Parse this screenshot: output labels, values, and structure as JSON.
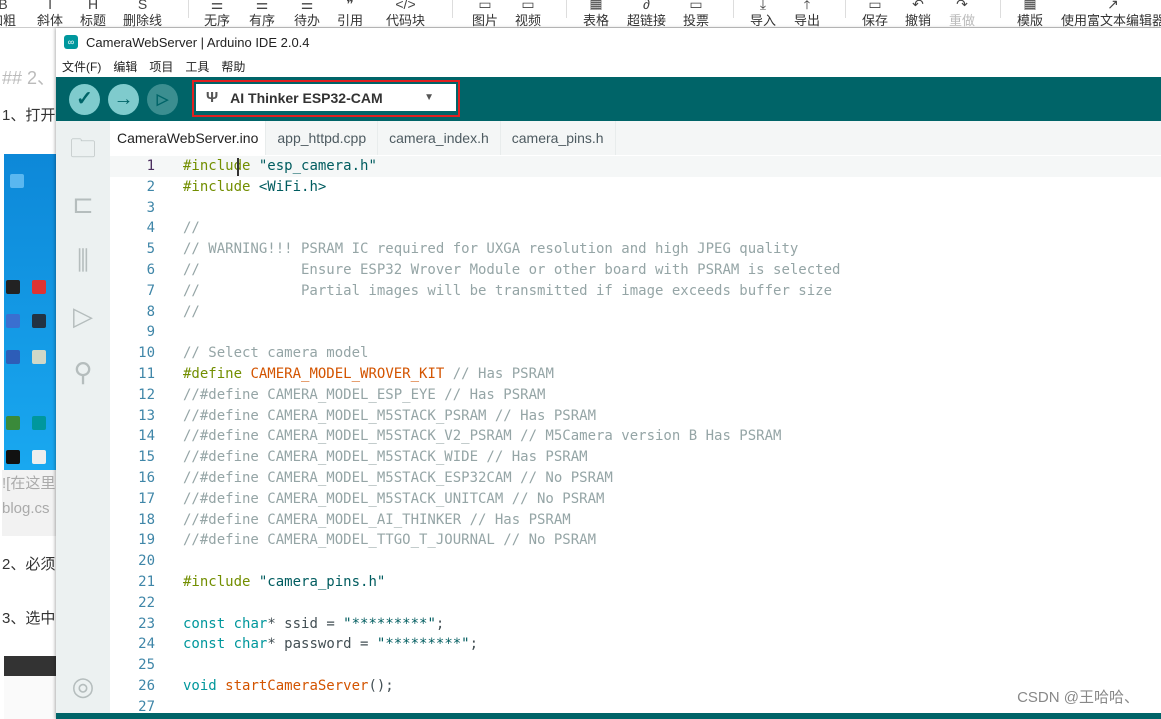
{
  "background_editor": {
    "toolbar": [
      {
        "label": "加粗",
        "icon": "bold-icon",
        "glyph": "B"
      },
      {
        "label": "斜体",
        "icon": "italic-icon",
        "glyph": "I"
      },
      {
        "label": "标题",
        "icon": "heading-icon",
        "glyph": "H"
      },
      {
        "label": "删除线",
        "icon": "strikethrough-icon",
        "glyph": "S"
      },
      {
        "label": "无序",
        "icon": "unordered-list-icon",
        "glyph": "☰"
      },
      {
        "label": "有序",
        "icon": "ordered-list-icon",
        "glyph": "☰"
      },
      {
        "label": "待办",
        "icon": "todo-icon",
        "glyph": "☰"
      },
      {
        "label": "引用",
        "icon": "quote-icon",
        "glyph": "❞"
      },
      {
        "label": "代码块",
        "icon": "code-block-icon",
        "glyph": "</>"
      },
      {
        "label": "图片",
        "icon": "image-icon",
        "glyph": "▭"
      },
      {
        "label": "视频",
        "icon": "video-icon",
        "glyph": "▭"
      },
      {
        "label": "表格",
        "icon": "table-icon",
        "glyph": "▦"
      },
      {
        "label": "超链接",
        "icon": "link-icon",
        "glyph": "∂"
      },
      {
        "label": "投票",
        "icon": "vote-icon",
        "glyph": "▭"
      },
      {
        "label": "导入",
        "icon": "import-icon",
        "glyph": "⤓"
      },
      {
        "label": "导出",
        "icon": "export-icon",
        "glyph": "⤒"
      },
      {
        "label": "保存",
        "icon": "save-icon",
        "glyph": "▭"
      },
      {
        "label": "撤销",
        "icon": "undo-icon",
        "glyph": "↶"
      },
      {
        "label": "重做",
        "icon": "redo-icon",
        "glyph": "↷"
      },
      {
        "label": "模版",
        "icon": "template-icon",
        "glyph": "▦"
      },
      {
        "label": "使用富文本编辑器",
        "icon": "rich-text-icon",
        "glyph": "↗"
      }
    ],
    "content": {
      "heading": "## 2、",
      "step1": "1、打开",
      "image_alt": "![在这里",
      "image_url": "blog.cs",
      "step2": "2、必须",
      "step3": "3、选中"
    },
    "watermark": "CSDN @王哈哈、"
  },
  "ide": {
    "title": "CameraWebServer | Arduino IDE 2.0.4",
    "menu": [
      "文件(F)",
      "编辑",
      "项目",
      "工具",
      "帮助"
    ],
    "board": "AI Thinker ESP32-CAM",
    "colors": {
      "toolbar": "#006468",
      "highlight_box": "#e02020"
    },
    "tabs": [
      "CameraWebServer.ino",
      "app_httpd.cpp",
      "camera_index.h",
      "camera_pins.h"
    ],
    "active_tab": 0,
    "code": [
      [
        [
          "pre",
          "#include"
        ],
        [
          "plain",
          " "
        ],
        [
          "str",
          "\"esp_camera.h\""
        ]
      ],
      [
        [
          "pre",
          "#include"
        ],
        [
          "plain",
          " "
        ],
        [
          "str",
          "<WiFi.h>"
        ]
      ],
      [],
      [
        [
          "com",
          "//"
        ]
      ],
      [
        [
          "com",
          "// WARNING!!! PSRAM IC required for UXGA resolution and high JPEG quality"
        ]
      ],
      [
        [
          "com",
          "//            Ensure ESP32 Wrover Module or other board with PSRAM is selected"
        ]
      ],
      [
        [
          "com",
          "//            Partial images will be transmitted if image exceeds buffer size"
        ]
      ],
      [
        [
          "com",
          "//"
        ]
      ],
      [],
      [
        [
          "com",
          "// Select camera model"
        ]
      ],
      [
        [
          "pre",
          "#define"
        ],
        [
          "plain",
          " "
        ],
        [
          "mac",
          "CAMERA_MODEL_WROVER_KIT"
        ],
        [
          "com",
          " // Has PSRAM"
        ]
      ],
      [
        [
          "com",
          "//#define CAMERA_MODEL_ESP_EYE // Has PSRAM"
        ]
      ],
      [
        [
          "com",
          "//#define CAMERA_MODEL_M5STACK_PSRAM // Has PSRAM"
        ]
      ],
      [
        [
          "com",
          "//#define CAMERA_MODEL_M5STACK_V2_PSRAM // M5Camera version B Has PSRAM"
        ]
      ],
      [
        [
          "com",
          "//#define CAMERA_MODEL_M5STACK_WIDE // Has PSRAM"
        ]
      ],
      [
        [
          "com",
          "//#define CAMERA_MODEL_M5STACK_ESP32CAM // No PSRAM"
        ]
      ],
      [
        [
          "com",
          "//#define CAMERA_MODEL_M5STACK_UNITCAM // No PSRAM"
        ]
      ],
      [
        [
          "com",
          "//#define CAMERA_MODEL_AI_THINKER // Has PSRAM"
        ]
      ],
      [
        [
          "com",
          "//#define CAMERA_MODEL_TTGO_T_JOURNAL // No PSRAM"
        ]
      ],
      [],
      [
        [
          "pre",
          "#include"
        ],
        [
          "plain",
          " "
        ],
        [
          "str",
          "\"camera_pins.h\""
        ]
      ],
      [],
      [
        [
          "kw",
          "const"
        ],
        [
          "plain",
          " "
        ],
        [
          "kw",
          "char"
        ],
        [
          "plain",
          "* ssid = "
        ],
        [
          "str",
          "\"*********\""
        ],
        [
          "plain",
          ";"
        ]
      ],
      [
        [
          "kw",
          "const"
        ],
        [
          "plain",
          " "
        ],
        [
          "kw",
          "char"
        ],
        [
          "plain",
          "* password = "
        ],
        [
          "str",
          "\"*********\""
        ],
        [
          "plain",
          ";"
        ]
      ],
      [],
      [
        [
          "kw",
          "void"
        ],
        [
          "plain",
          " "
        ],
        [
          "fn",
          "startCameraServer"
        ],
        [
          "plain",
          "();"
        ]
      ],
      []
    ]
  }
}
